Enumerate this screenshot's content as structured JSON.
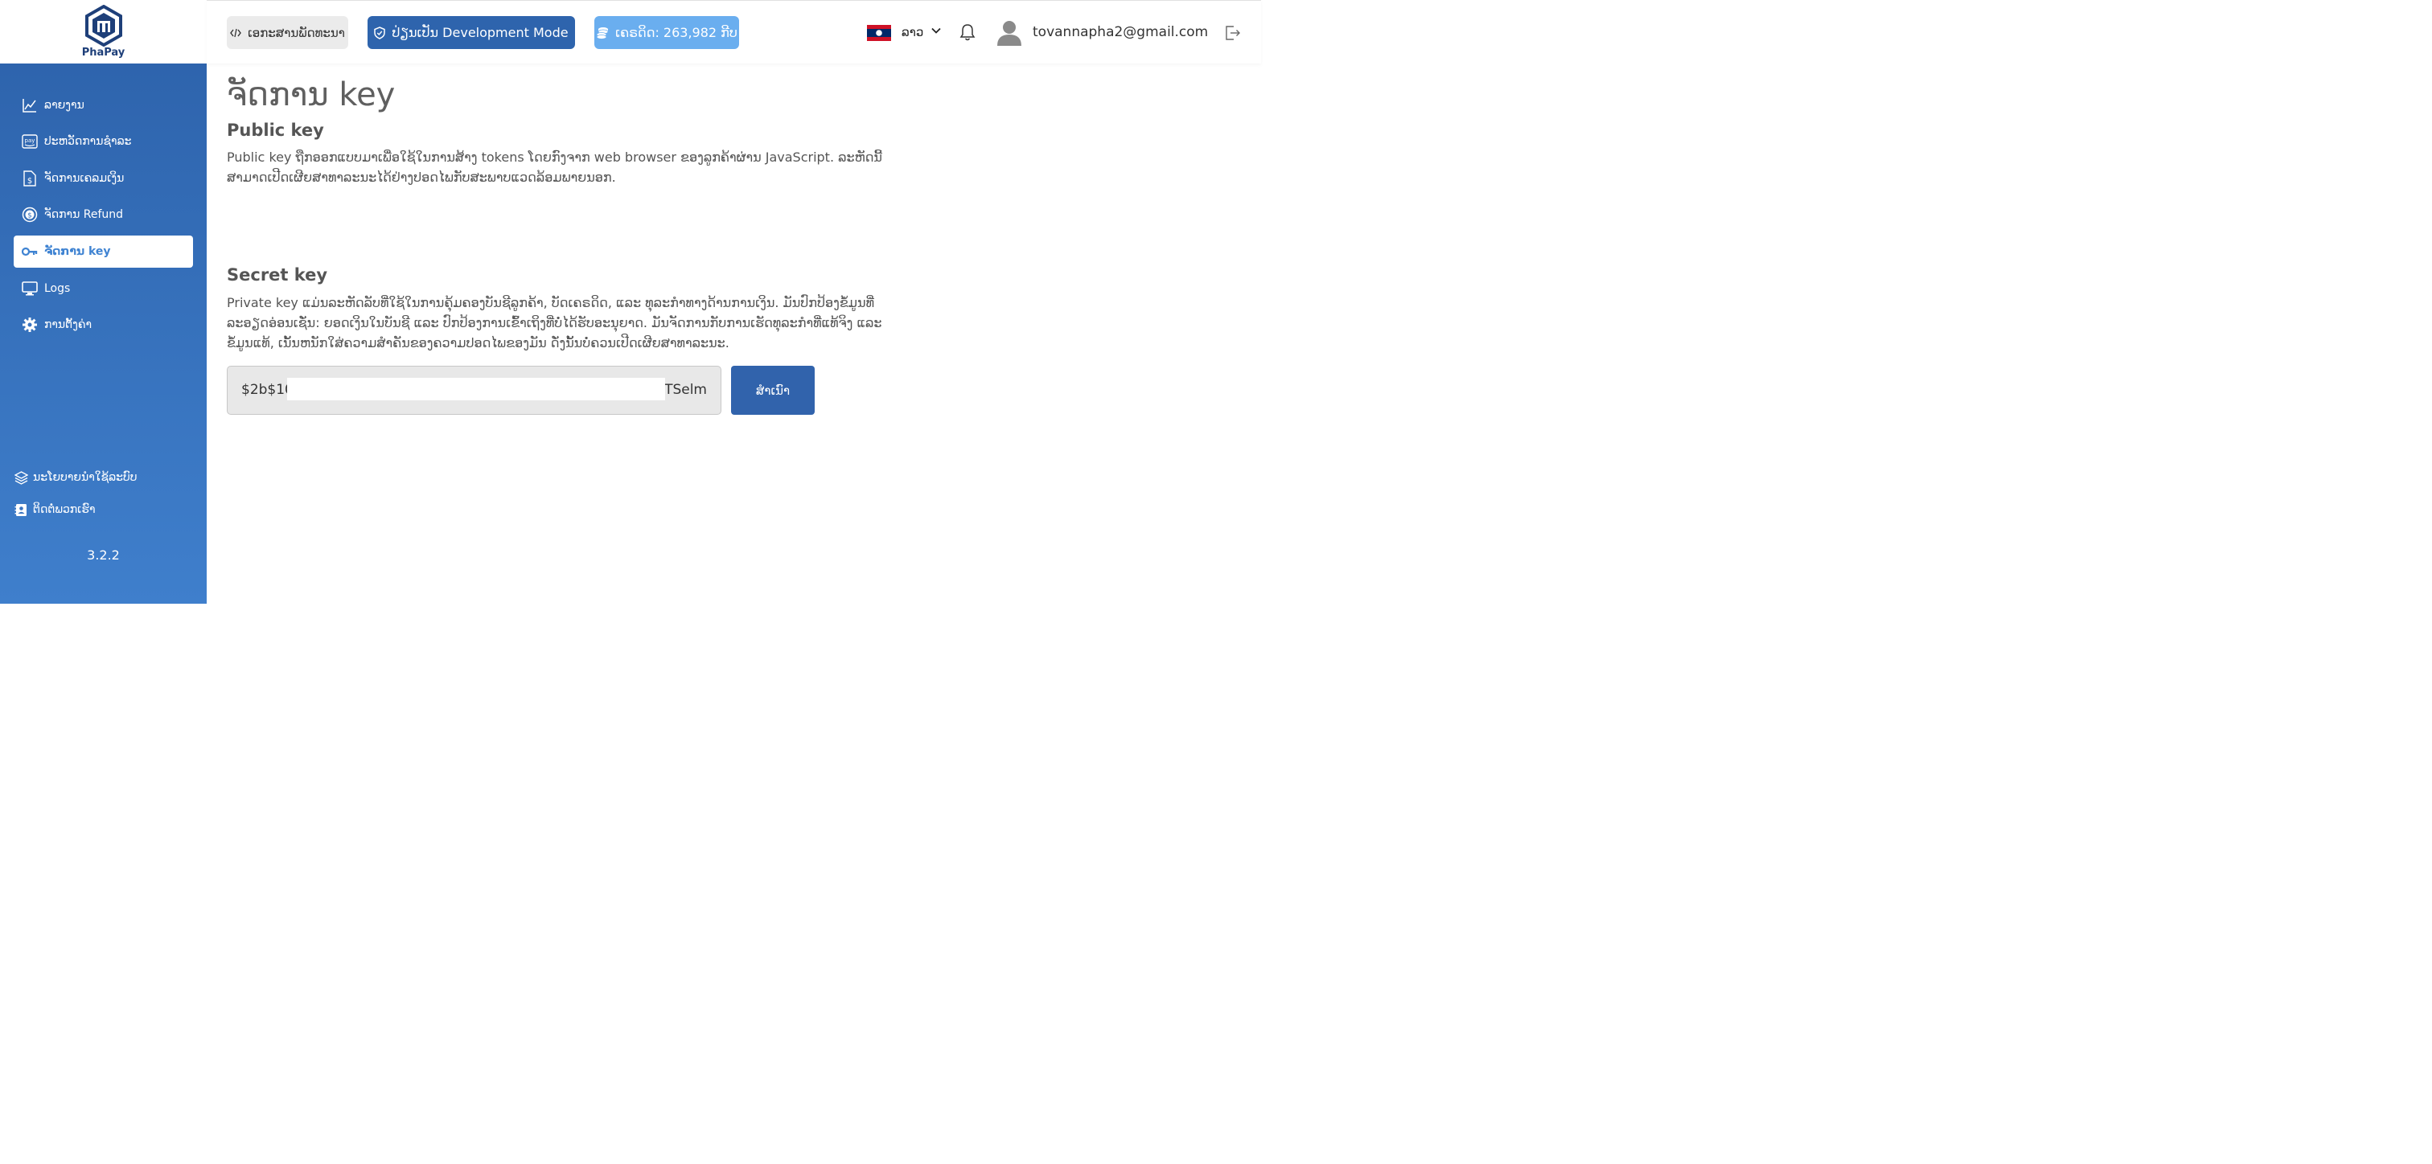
{
  "brand": {
    "logo_text": "PhaPay"
  },
  "sidebar": {
    "items": [
      {
        "label": "ລາຍງານ",
        "icon": "chart-line-icon"
      },
      {
        "label": "ປະຫວັດການຊໍາລະ",
        "icon": "pay-icon"
      },
      {
        "label": "ຈັດການເຄລມເງິນ",
        "icon": "invoice-dollar-icon"
      },
      {
        "label": "ຈັດການ Refund",
        "icon": "refund-icon"
      },
      {
        "label": "ຈັດການ key",
        "icon": "key-icon",
        "active": true
      },
      {
        "label": "Logs",
        "icon": "monitor-icon"
      },
      {
        "label": "ການຕັ້ງຄ່າ",
        "icon": "gear-icon"
      }
    ],
    "footer": [
      {
        "label": "ນະໂຍບາຍນໍາໃຊ້ລະບົບ",
        "icon": "layers-icon"
      },
      {
        "label": "ຕິດຕໍ່ພວກເຮົາ",
        "icon": "contact-book-icon"
      }
    ],
    "version": "3.2.2"
  },
  "header": {
    "docs_label": "ເອກະສານພັດທະນາ",
    "dev_mode_label": "ປ່ຽນເປັນ Development Mode",
    "credit_label": "ເຄຣດິດ: 263,982 ກີບ",
    "language": "ລາວ",
    "email": "tovannapha2@gmail.com"
  },
  "main": {
    "title": "ຈັດການ key",
    "public_key": {
      "title": "Public key",
      "description": "Public key ຖືກອອກແບບມາເພື່ອໃຊ້ໃນການສ້າງ tokens ໂດຍກົງຈາກ web browser ຂອງລູກຄ້າຜ່ານ JavaScript. ລະຫັດນີ້ສາມາດເປີດເຜີຍສາທາລະນະໄດ້ຢ່າງປອດໄພກັບສະພາບແວດລ້ອມພາຍນອກ."
    },
    "secret_key": {
      "title": "Secret key",
      "description": "Private key ແມ່ນລະຫັດລັບທີ່ໃຊ້ໃນການຄຸ້ມຄອງບັນຊີລູກຄ້າ, ບັດເຄຣດິດ, ແລະ ທຸລະກໍາທາງດ້ານການເງິນ. ມັນປົກປ້ອງຂໍ້ມູນທີ່ລະອຽດອ່ອນເຊັ່ນ: ຍອດເງິນໃນບັນຊີ ແລະ ປົກປ້ອງການເຂົ້າເຖິງທີ່ບໍ່ໄດ້ຮັບອະນຸຍາດ. ມັນຈັດການກັບການເຮັດທຸລະກໍາທີ່ແທ້ຈິງ ແລະ ຂໍ້ມູນແທ້, ເນັ້ນຫນັກໃສ່ຄວາມສໍາຄັນຂອງຄວາມປອດໄພຂອງມັນ ດັ່ງນັ້ນບໍ່ຄວນເປີດເຜີຍສາທາລະນະ.",
      "value_prefix": "$2b$10",
      "value_suffix": "NTSelm",
      "copy_label": "ສໍາເນົາ"
    }
  },
  "colors": {
    "primary": "#2e64ad",
    "accent": "#6aaeef",
    "active_text": "#3f83d2"
  }
}
